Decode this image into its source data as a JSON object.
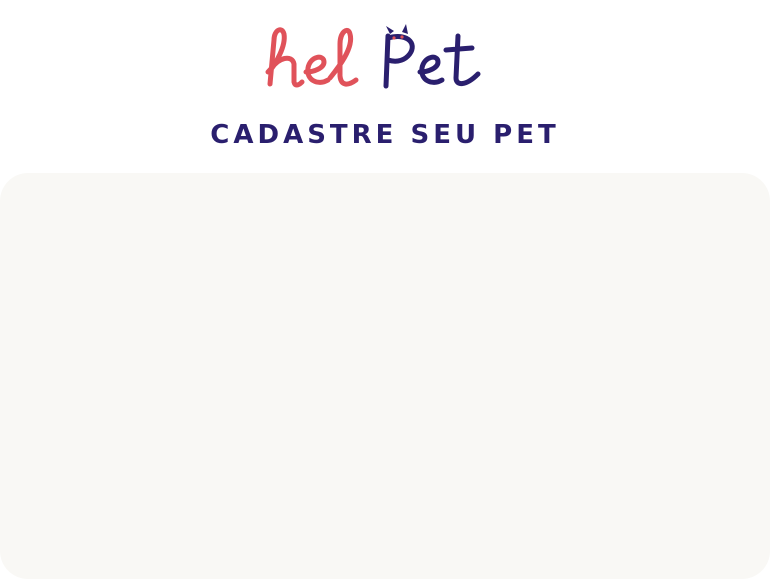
{
  "brand": {
    "logo_text_part1": "hel",
    "logo_text_part2": "Pet",
    "logo_color_part1": "#e0525a",
    "logo_color_part2": "#2a1f6e"
  },
  "header": {
    "title": "CADASTRE SEU PET"
  },
  "colors": {
    "title": "#2a1f6e",
    "panel_background": "#f9f8f5",
    "page_background": "#ffffff"
  }
}
